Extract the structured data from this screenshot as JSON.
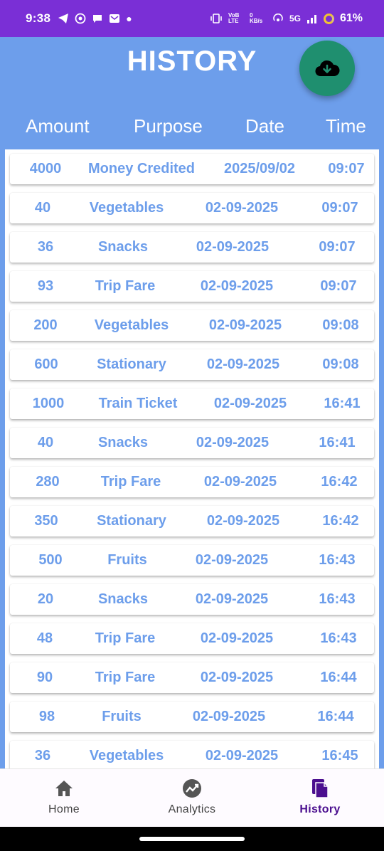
{
  "status_bar": {
    "time": "9:38",
    "network": "5G",
    "battery": "61%",
    "volte": "VoB LTE",
    "speed": "0 KB/s"
  },
  "title": "HISTORY",
  "columns": [
    "Amount",
    "Purpose",
    "Date",
    "Time"
  ],
  "rows": [
    {
      "amount": "4000",
      "purpose": "Money Credited",
      "date": "2025/09/02",
      "time": "09:07"
    },
    {
      "amount": "40",
      "purpose": "Vegetables",
      "date": "02-09-2025",
      "time": "09:07"
    },
    {
      "amount": "36",
      "purpose": "Snacks",
      "date": "02-09-2025",
      "time": "09:07"
    },
    {
      "amount": "93",
      "purpose": "Trip Fare",
      "date": "02-09-2025",
      "time": "09:07"
    },
    {
      "amount": "200",
      "purpose": "Vegetables",
      "date": "02-09-2025",
      "time": "09:08"
    },
    {
      "amount": "600",
      "purpose": "Stationary",
      "date": "02-09-2025",
      "time": "09:08"
    },
    {
      "amount": "1000",
      "purpose": "Train Ticket",
      "date": "02-09-2025",
      "time": "16:41"
    },
    {
      "amount": "40",
      "purpose": "Snacks",
      "date": "02-09-2025",
      "time": "16:41"
    },
    {
      "amount": "280",
      "purpose": "Trip Fare",
      "date": "02-09-2025",
      "time": "16:42"
    },
    {
      "amount": "350",
      "purpose": "Stationary",
      "date": "02-09-2025",
      "time": "16:42"
    },
    {
      "amount": "500",
      "purpose": "Fruits",
      "date": "02-09-2025",
      "time": "16:43"
    },
    {
      "amount": "20",
      "purpose": "Snacks",
      "date": "02-09-2025",
      "time": "16:43"
    },
    {
      "amount": "48",
      "purpose": "Trip Fare",
      "date": "02-09-2025",
      "time": "16:43"
    },
    {
      "amount": "90",
      "purpose": "Trip Fare",
      "date": "02-09-2025",
      "time": "16:44"
    },
    {
      "amount": "98",
      "purpose": "Fruits",
      "date": "02-09-2025",
      "time": "16:44"
    },
    {
      "amount": "36",
      "purpose": "Vegetables",
      "date": "02-09-2025",
      "time": "16:45"
    }
  ],
  "bottom_nav": {
    "items": [
      {
        "label": "Home",
        "icon": "home-icon"
      },
      {
        "label": "Analytics",
        "icon": "analytics-icon"
      },
      {
        "label": "History",
        "icon": "history-icon",
        "active": true
      }
    ]
  },
  "colors": {
    "status_bar": "#7a2fd6",
    "background": "#6d9eeb",
    "fab": "#1f8f6f",
    "row_text": "#6d9eeb",
    "active_nav": "#4b0f8f"
  }
}
